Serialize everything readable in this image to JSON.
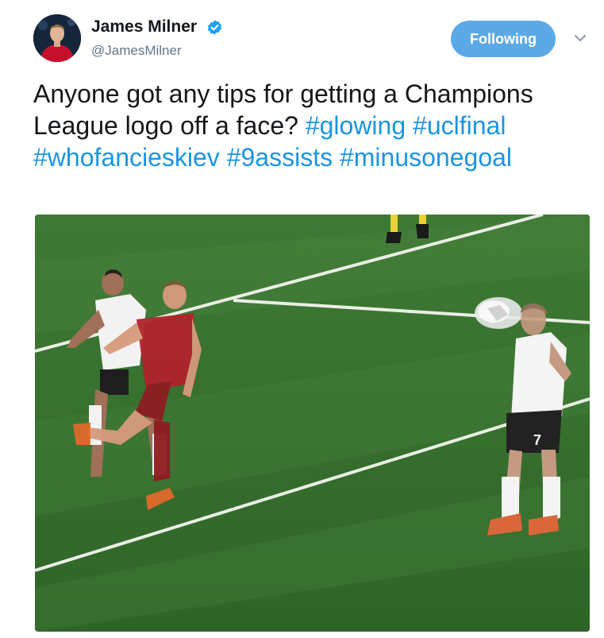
{
  "tweet": {
    "author": {
      "name": "James Milner",
      "handle": "@JamesMilner",
      "verified": true,
      "avatar_icon": "avatar-player-photo"
    },
    "follow_button": {
      "label": "Following",
      "color": "#5ca9e6"
    },
    "menu_icon": "chevron-down-icon",
    "text": "Anyone got any tips for getting a Champions League logo off a face?",
    "hashtags": [
      "#glowing",
      "#uclfinal",
      "#whofancieskiev",
      "#9assists",
      "#minusonegoal"
    ],
    "hashtag_color": "#1b95e0",
    "media": {
      "type": "photo",
      "shirt_number": "7"
    }
  }
}
